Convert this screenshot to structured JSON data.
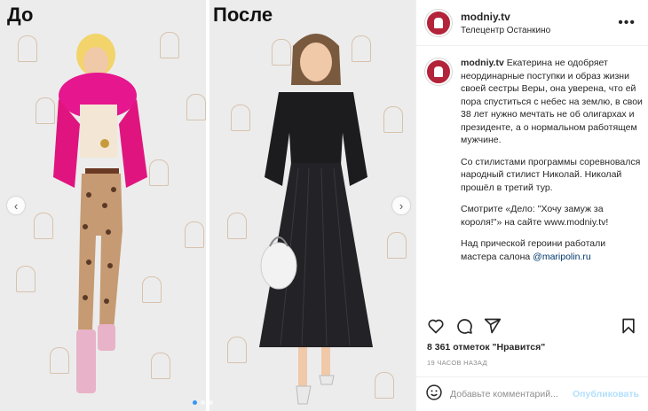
{
  "media": {
    "before_label": "До",
    "after_label": "После",
    "carousel": {
      "slides": 3,
      "active": 1
    }
  },
  "post": {
    "username": "modniy.tv",
    "location": "Телецентр Останкино",
    "caption": {
      "username": "modniy.tv",
      "p1": "Екатерина не одобряет неординарные поступки и образ жизни своей сестры Веры, она уверена, что ей пора спуститься с небес на землю, в свои 38 лет нужно мечтать не об олигархах и президенте, а о нормальном работящем мужчине.",
      "p2": "Со стилистами программы соревновался народный стилист Николай. Николай прошёл в третий тур.",
      "p3": "Смотрите «Дело: \"Хочу замуж за короля!\"» на сайте www.modniy.tv!",
      "p4_text": "Над прической героини работали мастера салона ",
      "p4_mention": "@maripolin.ru"
    },
    "likes": "8 361 отметок \"Нравится\"",
    "time": "19 ЧАСОВ НАЗАД",
    "comment_placeholder": "Добавьте комментарий...",
    "publish": "Опубликовать"
  },
  "icons": {
    "like": "heart-icon",
    "comment": "comment-icon",
    "share": "send-icon",
    "save": "bookmark-icon",
    "emoji": "emoji-icon",
    "more": "more-icon"
  },
  "colors": {
    "accent": "#3897f0",
    "avatar": "#b3233a",
    "publish_disabled": "#b2dffc",
    "mention": "#00376b"
  }
}
